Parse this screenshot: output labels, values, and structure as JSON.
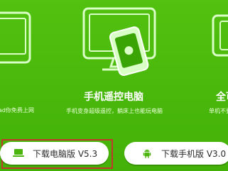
{
  "features": {
    "left": {
      "title": "",
      "description": "ad你免费上网"
    },
    "center": {
      "title": "手机遥控电脑",
      "description": "手机变身超级遥控，躺床上也能玩电脑"
    },
    "right": {
      "title": "全可",
      "description": "单机不要电"
    }
  },
  "buttons": {
    "download_pc": "下载电脑版 V5.3",
    "download_mobile": "下载手机版 V3.0"
  },
  "colors": {
    "background": "#49b80c",
    "button_bg": "#ffffff",
    "highlight_border": "#c0392b"
  },
  "icons": {
    "pc_button": "laptop-icon",
    "mobile_button": "android-icon"
  }
}
